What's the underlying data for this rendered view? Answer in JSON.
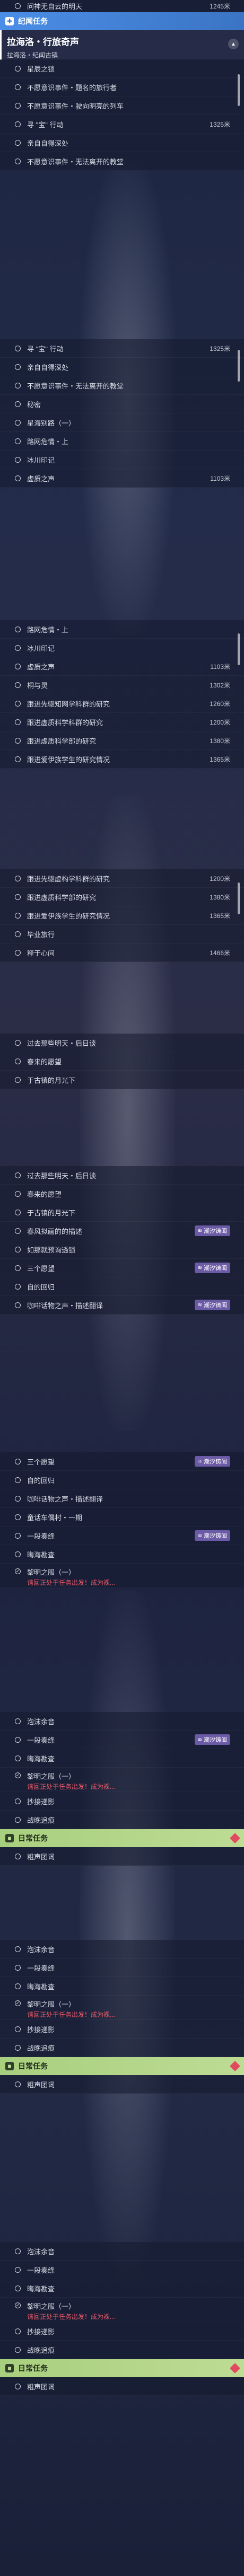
{
  "colors": {
    "blue_header": "#4b8ee6",
    "green_header": "#a8cf7e",
    "tag": "#6b5aa6",
    "warning": "#f05a6a"
  },
  "top": {
    "first_row": {
      "label": "问神无自云的明天",
      "dist": "1245米"
    },
    "header": {
      "icon": "plus-icon",
      "label": "纪闻任务"
    },
    "card": {
      "title": "拉海洛・行旅奇声",
      "subtitle": "拉海洛・纪闻古镇"
    }
  },
  "blocks": {
    "a": [
      {
        "label": "星辰之锁",
        "dist": ""
      },
      {
        "label": "不愿意识事件・题名的旅行者",
        "dist": ""
      },
      {
        "label": "不愿意识事件・驶向明亮的列车",
        "dist": ""
      },
      {
        "label": "寻 \"宝\" 行动",
        "dist": "1325米"
      },
      {
        "label": "亲自自得深处",
        "dist": ""
      },
      {
        "label": "不愿意识事件・无法离开的教堂",
        "dist": ""
      }
    ],
    "b": [
      {
        "label": "寻 \"宝\" 行动",
        "dist": "1325米"
      },
      {
        "label": "亲自自得深处",
        "dist": ""
      },
      {
        "label": "不愿意识事件・无法离开的教堂",
        "dist": ""
      },
      {
        "label": "秘密",
        "dist": ""
      },
      {
        "label": "星海别路（一）",
        "dist": ""
      },
      {
        "label": "路网危情・上",
        "dist": ""
      },
      {
        "label": "冰川印记",
        "dist": ""
      },
      {
        "label": "虚质之声",
        "dist": "1103米"
      }
    ],
    "c": [
      {
        "label": "路网危情・上",
        "dist": ""
      },
      {
        "label": "冰川印记",
        "dist": ""
      },
      {
        "label": "虚质之声",
        "dist": "1103米"
      },
      {
        "label": "桐与灵",
        "dist": "1302米"
      },
      {
        "label": "跟进先驱知网学科群的研究",
        "dist": "1260米"
      },
      {
        "label": "跟进虚质科学科群的研究",
        "dist": "1200米"
      },
      {
        "label": "跟进虚质科学部的研究",
        "dist": "1380米"
      },
      {
        "label": "跟进爱伊族学生的研究情况",
        "dist": "1365米"
      }
    ],
    "d": [
      {
        "label": "跟进先驱虚构学科群的研究",
        "dist": "1200米"
      },
      {
        "label": "跟进虚质科学部的研究",
        "dist": "1380米"
      },
      {
        "label": "跟进爱伊族学生的研究情况",
        "dist": "1365米"
      },
      {
        "label": "毕业旅行",
        "dist": ""
      },
      {
        "label": "释于心间",
        "dist": "1466米"
      }
    ],
    "e": [
      {
        "label": "过去那些明天・后日谈",
        "dist": ""
      },
      {
        "label": "春来的愿望",
        "dist": ""
      },
      {
        "label": "于古镇的月光下",
        "dist": ""
      }
    ],
    "f": [
      {
        "label": "过去那些明天・后日谈",
        "tag": ""
      },
      {
        "label": "春来的愿望",
        "tag": ""
      },
      {
        "label": "于古镇的月光下",
        "tag": ""
      },
      {
        "label": "春风拟画的的描述",
        "tag": "潮汐铸阖"
      },
      {
        "label": "如那就预询透锁",
        "tag": ""
      },
      {
        "label": "三个愿望",
        "tag": "潮汐铸阖"
      },
      {
        "label": "自的回归",
        "tag": ""
      },
      {
        "label": "咖啡话物之声・描述翻译",
        "tag": "潮汐铸阖"
      }
    ],
    "g": [
      {
        "label": "三个愿望",
        "tag": "潮汐铸阖"
      },
      {
        "label": "自的回归",
        "tag": ""
      },
      {
        "label": "咖啡话物之声・描述翻译",
        "tag": ""
      },
      {
        "label": "童话车偶村・一期",
        "tag": ""
      },
      {
        "label": "一段奏绦",
        "tag": "潮汐铸阖"
      },
      {
        "label": "晦海勘查",
        "tag": ""
      }
    ],
    "g_last": {
      "label": "黎明之服（一）",
      "warn": "请回正处于任务出发！成为裸..."
    },
    "h": [
      {
        "label": "泡沫余音",
        "tag": ""
      },
      {
        "label": "一段奏绦",
        "tag": "潮汐铸阖"
      },
      {
        "label": "晦海勘查",
        "tag": ""
      }
    ],
    "h_warn": {
      "label": "黎明之服（一）",
      "warn": "请回正处于任务出发！成为裸..."
    },
    "h_tail": [
      {
        "label": "抄接递影",
        "tag": ""
      },
      {
        "label": "战晚追痕",
        "tag": ""
      }
    ],
    "daily_header": {
      "icon": "daily-icon",
      "label": "日常任务"
    },
    "daily_row": "粗声团词"
  }
}
